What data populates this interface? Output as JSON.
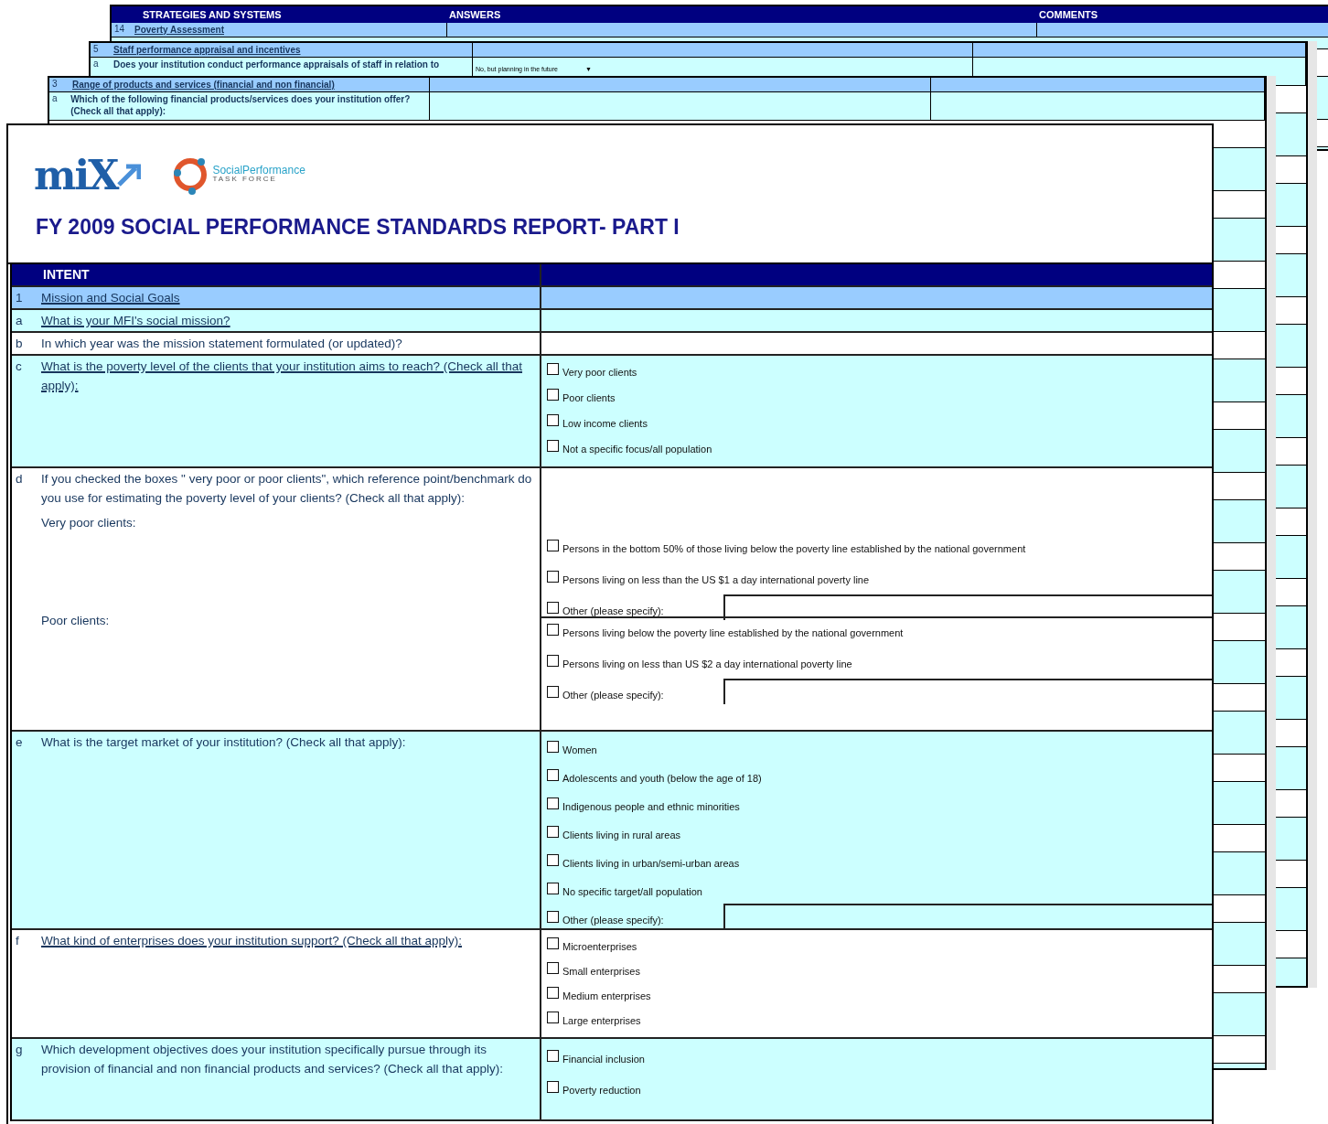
{
  "back_pages": [
    {
      "columns": [
        "STRATEGIES AND SYSTEMS",
        "ANSWERS",
        "COMMENTS"
      ],
      "rows": [
        {
          "number": "14",
          "title": "Poverty Assessment",
          "kind": "section"
        }
      ]
    },
    {
      "rows": [
        {
          "number": "5",
          "title": "Staff performance appraisal and incentives",
          "kind": "section"
        },
        {
          "number": "a",
          "title": "Does your institution conduct performance appraisals of staff in relation to",
          "kind": "question",
          "dropdown": {
            "value": "No, but planning in the future",
            "caret": "▼"
          }
        }
      ]
    },
    {
      "rows": [
        {
          "number": "3",
          "title": "Range of products and services (financial and non financial)",
          "kind": "section"
        },
        {
          "number": "a",
          "title": "Which of the following financial products/services does  your institution offer? (Check all that apply):",
          "kind": "question"
        }
      ]
    }
  ],
  "front_page": {
    "logos": [
      {
        "kind": "mix",
        "text": "miX"
      },
      {
        "kind": "sptf",
        "text": "SocialPerformance",
        "subtext": "TASK FORCE"
      }
    ],
    "title": "FY 2009 SOCIAL PERFORMANCE STANDARDS REPORT- PART I",
    "header": "INTENT",
    "section": {
      "number": "1",
      "title": "Mission and Social Goals"
    },
    "questions": [
      {
        "letter": "a",
        "text": "What is your MFI's social mission?",
        "link": true
      },
      {
        "letter": "b",
        "text": "In which year was the mission statement formulated (or updated)?",
        "link": false
      },
      {
        "letter": "c",
        "text": "What is the poverty level of the clients that your institution aims to reach? (Check all that apply):",
        "link": true,
        "groups": [
          {
            "options": [
              {
                "label": "Very poor clients",
                "checked": false,
                "kind": "checkbox"
              },
              {
                "label": "Poor clients",
                "checked": false,
                "kind": "checkbox"
              },
              {
                "label": "Low income clients",
                "checked": false,
                "kind": "checkbox"
              },
              {
                "label": "Not a specific focus/all population",
                "checked": false,
                "kind": "checkbox"
              }
            ]
          }
        ]
      },
      {
        "letter": "d",
        "text": "If you checked the boxes \" very poor or poor clients\", which reference point/benchmark do you use for estimating the poverty level of your clients? (Check all that apply):",
        "link": false,
        "groups": [
          {
            "label": "Very poor clients:",
            "options": [
              {
                "label": "Persons in the bottom 50% of those living below the poverty line established by the national government",
                "checked": false,
                "kind": "checkbox"
              },
              {
                "label": "Persons living on less than the US $1 a day international poverty line",
                "checked": false,
                "kind": "checkbox"
              },
              {
                "label": "Other (please specify):",
                "checked": false,
                "kind": "other"
              }
            ]
          },
          {
            "label": "Poor clients:",
            "options": [
              {
                "label": "Persons living below the poverty line established by the national government",
                "checked": false,
                "kind": "checkbox"
              },
              {
                "label": "Persons living on less than US $2 a day international poverty line",
                "checked": false,
                "kind": "checkbox"
              },
              {
                "label": "Other (please specify):",
                "checked": false,
                "kind": "other"
              }
            ]
          }
        ]
      },
      {
        "letter": "e",
        "text": "What is the target market of your institution?  (Check all that apply):",
        "link": false,
        "groups": [
          {
            "options": [
              {
                "label": "Women",
                "checked": false,
                "kind": "checkbox"
              },
              {
                "label": "Adolescents and youth (below the age of 18)",
                "checked": false,
                "kind": "checkbox"
              },
              {
                "label": "Indigenous people and ethnic minorities",
                "checked": false,
                "kind": "checkbox"
              },
              {
                "label": "Clients living in rural areas",
                "checked": false,
                "kind": "checkbox"
              },
              {
                "label": "Clients living in urban/semi-urban areas",
                "checked": false,
                "kind": "checkbox"
              },
              {
                "label": "No specific target/all population",
                "checked": false,
                "kind": "checkbox"
              },
              {
                "label": "Other (please specify):",
                "checked": false,
                "kind": "other"
              }
            ]
          }
        ]
      },
      {
        "letter": "f",
        "text": "What kind of enterprises does your institution support? (Check all that apply):",
        "link": true,
        "groups": [
          {
            "options": [
              {
                "label": "Microenterprises",
                "checked": false,
                "kind": "checkbox"
              },
              {
                "label": "Small enterprises",
                "checked": false,
                "kind": "checkbox"
              },
              {
                "label": "Medium enterprises",
                "checked": false,
                "kind": "checkbox"
              },
              {
                "label": "Large enterprises",
                "checked": false,
                "kind": "checkbox"
              }
            ]
          }
        ]
      },
      {
        "letter": "g",
        "text": "Which development objectives does your institution specifically pursue through its provision of financial and non financial products and services? (Check all that apply):",
        "link": false,
        "groups": [
          {
            "options": [
              {
                "label": "Financial inclusion",
                "checked": false,
                "kind": "checkbox"
              },
              {
                "label": "Poverty reduction",
                "checked": false,
                "kind": "checkbox"
              }
            ]
          }
        ]
      }
    ]
  }
}
